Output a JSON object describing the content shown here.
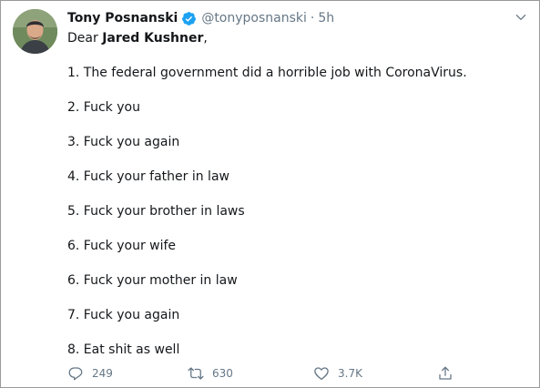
{
  "tweet": {
    "author_name": "Tony Posnanski",
    "handle": "@tonyposnanski",
    "separator": "·",
    "time": "5h",
    "greeting_prefix": "Dear ",
    "greeting_name": "Jared Kushner",
    "greeting_suffix": ",",
    "lines": [
      "1. The federal government did a horrible job with CoronaVirus.",
      "2. Fuck you",
      "3. Fuck you again",
      "4. Fuck your father in law",
      "5. Fuck your brother in laws",
      "6. Fuck your wife",
      "6. Fuck your mother in law",
      "7. Fuck you again",
      "8. Eat shit as well"
    ],
    "replies": "249",
    "retweets": "630",
    "likes": "3.7K"
  },
  "icons": {
    "verified": "verified-badge-icon",
    "caret": "chevron-down-icon",
    "reply": "reply-icon",
    "retweet": "retweet-icon",
    "like": "heart-icon",
    "share": "share-icon"
  },
  "colors": {
    "text": "#14171a",
    "muted": "#657786",
    "verified": "#1da1f2"
  }
}
